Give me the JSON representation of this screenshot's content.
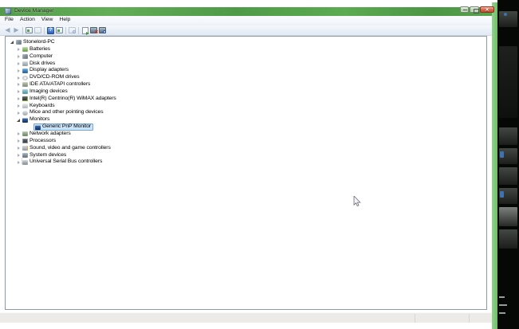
{
  "window": {
    "title": "Device Manager",
    "icon": "device-manager-icon",
    "caption_buttons": [
      "minimize-icon",
      "maximize-icon",
      "close-icon"
    ]
  },
  "menu": {
    "items": [
      "File",
      "Action",
      "View",
      "Help"
    ]
  },
  "toolbar": {
    "buttons": [
      "back-icon",
      "forward-icon",
      "show-console-tree-icon",
      "export-list-icon",
      "help-icon",
      "properties-icon",
      "find-icon",
      "update-driver-icon",
      "uninstall-device-icon",
      "scan-hardware-changes-icon"
    ]
  },
  "tree": {
    "items": [
      {
        "label": "Stonelord-PC",
        "level": 0,
        "state": "expanded",
        "icon": "computer-icon",
        "selected": false
      },
      {
        "label": "Batteries",
        "level": 1,
        "state": "collapsed",
        "icon": "battery-icon",
        "selected": false
      },
      {
        "label": "Computer",
        "level": 1,
        "state": "collapsed",
        "icon": "computer-icon",
        "selected": false
      },
      {
        "label": "Disk drives",
        "level": 1,
        "state": "collapsed",
        "icon": "disk-drive-icon",
        "selected": false
      },
      {
        "label": "Display adapters",
        "level": 1,
        "state": "collapsed",
        "icon": "display-adapter-icon",
        "selected": false
      },
      {
        "label": "DVD/CD-ROM drives",
        "level": 1,
        "state": "collapsed",
        "icon": "dvd-drive-icon",
        "selected": false
      },
      {
        "label": "IDE ATA/ATAPI controllers",
        "level": 1,
        "state": "collapsed",
        "icon": "ide-controller-icon",
        "selected": false
      },
      {
        "label": "Imaging devices",
        "level": 1,
        "state": "collapsed",
        "icon": "imaging-device-icon",
        "selected": false
      },
      {
        "label": "Intel(R) Centrino(R) WiMAX adapters",
        "level": 1,
        "state": "collapsed",
        "icon": "wimax-adapter-icon",
        "selected": false
      },
      {
        "label": "Keyboards",
        "level": 1,
        "state": "collapsed",
        "icon": "keyboard-icon",
        "selected": false
      },
      {
        "label": "Mice and other pointing devices",
        "level": 1,
        "state": "collapsed",
        "icon": "mouse-icon",
        "selected": false
      },
      {
        "label": "Monitors",
        "level": 1,
        "state": "expanded",
        "icon": "monitor-icon",
        "selected": false
      },
      {
        "label": "Generic PnP Monitor",
        "level": 2,
        "state": "leaf",
        "icon": "monitor-icon",
        "selected": true
      },
      {
        "label": "Network adapters",
        "level": 1,
        "state": "collapsed",
        "icon": "network-adapter-icon",
        "selected": false
      },
      {
        "label": "Processors",
        "level": 1,
        "state": "collapsed",
        "icon": "processor-icon",
        "selected": false
      },
      {
        "label": "Sound, video and game controllers",
        "level": 1,
        "state": "collapsed",
        "icon": "sound-controller-icon",
        "selected": false
      },
      {
        "label": "System devices",
        "level": 1,
        "state": "collapsed",
        "icon": "system-device-icon",
        "selected": false
      },
      {
        "label": "Universal Serial Bus controllers",
        "level": 1,
        "state": "collapsed",
        "icon": "usb-controller-icon",
        "selected": false
      }
    ]
  },
  "colors": {
    "titlebar_green": "#549c4b",
    "frame_green": "#7ec878",
    "close_button_red": "#c14f31",
    "selection_bg": "#cbe4fa",
    "selection_border": "#74a7d8",
    "desktop_bg": "#060806"
  }
}
